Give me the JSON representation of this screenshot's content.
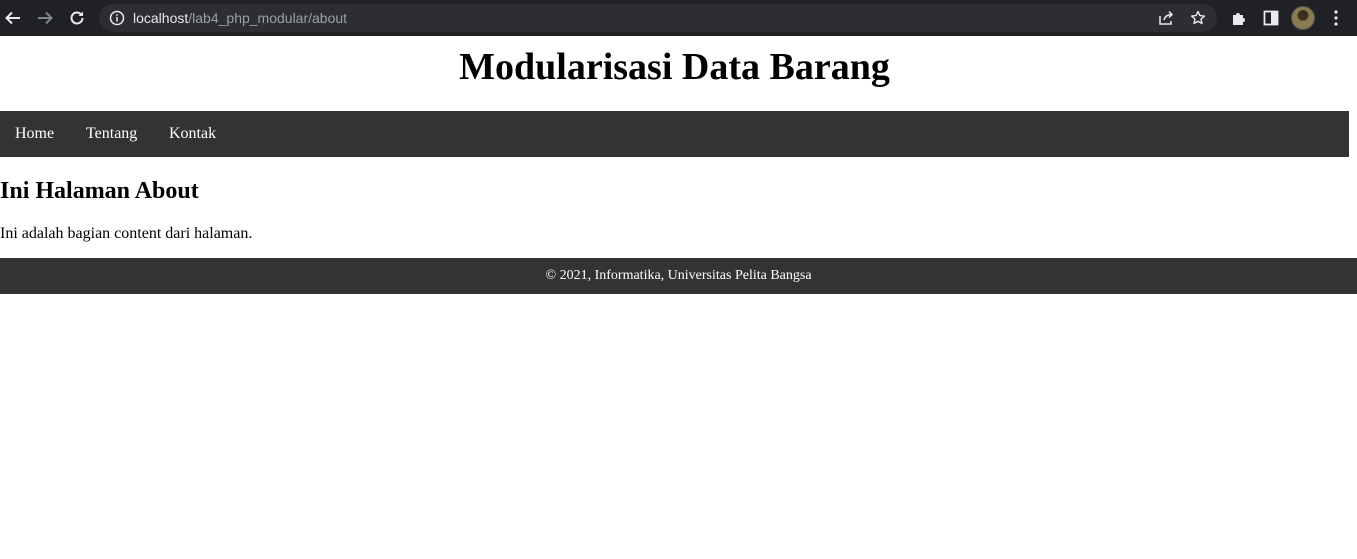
{
  "browser": {
    "url_host": "localhost",
    "url_path": "/lab4_php_modular/about",
    "icons": [
      "back-arrow-icon",
      "forward-arrow-icon",
      "reload-icon",
      "site-info-icon",
      "share-icon",
      "bookmark-star-icon",
      "extensions-icon",
      "side-panel-icon",
      "profile-avatar",
      "menu-kebab-icon"
    ]
  },
  "page": {
    "site_title": "Modularisasi Data Barang",
    "nav": [
      {
        "label": "Home"
      },
      {
        "label": "Tentang"
      },
      {
        "label": "Kontak"
      }
    ],
    "heading": "Ini Halaman About",
    "content": "Ini adalah bagian content dari halaman.",
    "footer": "© 2021, Informatika, Universitas Pelita Bangsa"
  },
  "colors": {
    "chrome_bg": "#202124",
    "omnibox_bg": "#2d2e31",
    "navbar_bg": "#333333",
    "footer_bg": "#333333",
    "nav_text": "#ffffff"
  }
}
